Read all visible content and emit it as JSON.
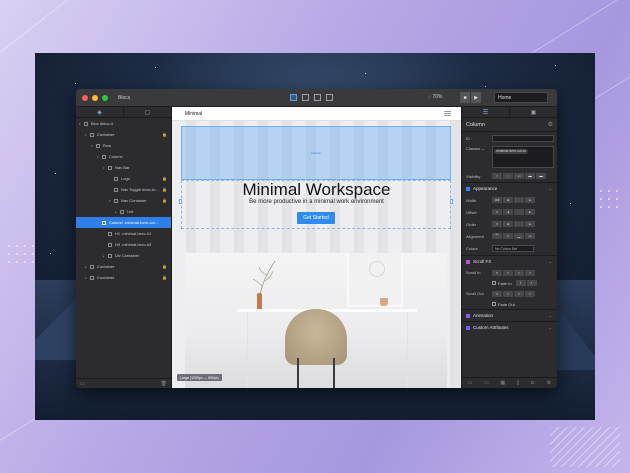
{
  "app": {
    "title": "Blocs",
    "zoom": "70%",
    "page_select": "Home"
  },
  "toolbar": {
    "view_icons": [
      "desktop-icon",
      "tablet-icon",
      "mobile-icon",
      "small-mobile-icon"
    ],
    "play_labels": [
      "■",
      "▶"
    ]
  },
  "left_panel": {
    "tabs": [
      "◈",
      "▢"
    ],
    "tree": [
      {
        "label": "Bloc #bloc-4",
        "depth": 0,
        "arrow": "▾"
      },
      {
        "label": "Container",
        "depth": 1,
        "arrow": "▾",
        "lock": true
      },
      {
        "label": "Row",
        "depth": 2,
        "arrow": "▾"
      },
      {
        "label": "Column",
        "depth": 3,
        "arrow": "▾"
      },
      {
        "label": "Nav Bar",
        "depth": 4,
        "arrow": "▾"
      },
      {
        "label": "Logo",
        "depth": 5,
        "arrow": "",
        "lock": true
      },
      {
        "label": "Nav Toggle #nav-to...",
        "depth": 5,
        "arrow": "",
        "lock": true
      },
      {
        "label": "Nav Container",
        "depth": 5,
        "arrow": "▾",
        "lock": true
      },
      {
        "label": "List",
        "depth": 6,
        "arrow": "▸"
      },
      {
        "label": "Column .minimal-hero-col...",
        "depth": 3,
        "arrow": "▾",
        "selected": true
      },
      {
        "label": "H1 .minimal-hero-h1",
        "depth": 4,
        "arrow": ""
      },
      {
        "label": "H3 .minimal-hero-h3",
        "depth": 4,
        "arrow": ""
      },
      {
        "label": "Div Container",
        "depth": 4,
        "arrow": "▸"
      },
      {
        "label": "Container",
        "depth": 1,
        "arrow": "▸",
        "lock": true
      },
      {
        "label": "Container",
        "depth": 1,
        "arrow": "▸",
        "lock": true
      }
    ],
    "footer": [
      "▭",
      "🗑"
    ]
  },
  "canvas": {
    "brand": "Minimal",
    "selection_tag": "Column",
    "headline": "Minimal Workspace",
    "subline": "Be more productive in a minimal work environment",
    "cta": "Get Started",
    "breakpoint": "Large (1200px — 992px)"
  },
  "right_panel": {
    "title": "Column",
    "id_label": "ID",
    "classes_label": "Classes",
    "class_chip": "minimal-hero-col-m",
    "visibility_label": "Visibility",
    "appearance": "Appearance",
    "width_label": "Width",
    "width_value": "col",
    "offset_label": "Offset",
    "order_label": "Order",
    "alignment_label": "Alignment",
    "colour_label": "Colour",
    "colour_value": "No Colour Set",
    "scroll_fx": "Scroll FX",
    "scroll_in": "Scroll In",
    "fade_in": "Fade In",
    "scroll_out": "Scroll Out",
    "fade_out": "Fade Out",
    "animation": "Animation",
    "custom_attributes": "Custom Attributes",
    "accent_colors": {
      "appearance": "#3b82f6",
      "scroll_fx": "#b455e0",
      "animation": "#8e5cf0",
      "custom": "#6a62f0"
    }
  }
}
